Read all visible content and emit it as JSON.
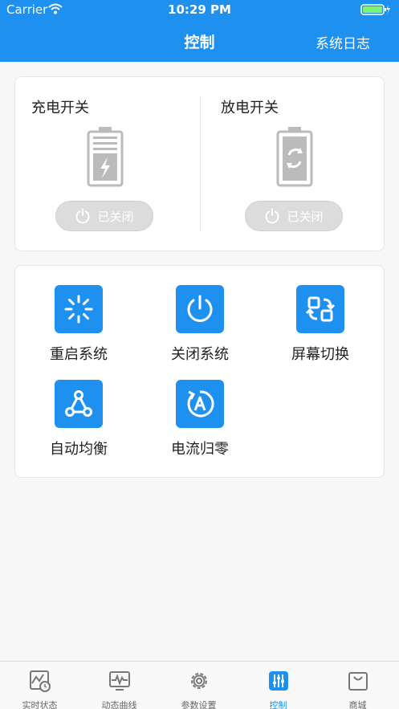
{
  "status_bar": {
    "carrier": "Carrier",
    "time": "10:29 PM"
  },
  "nav": {
    "title": "控制",
    "right_link": "系统日志"
  },
  "switches": [
    {
      "title": "充电开关",
      "button": "已关闭",
      "icon": "charging-battery-icon"
    },
    {
      "title": "放电开关",
      "button": "已关闭",
      "icon": "discharge-battery-icon"
    }
  ],
  "actions": [
    {
      "label": "重启系统",
      "icon": "restart-icon"
    },
    {
      "label": "关闭系统",
      "icon": "power-icon"
    },
    {
      "label": "屏幕切换",
      "icon": "screen-switch-icon"
    },
    {
      "label": "自动均衡",
      "icon": "balance-icon"
    },
    {
      "label": "电流归零",
      "icon": "current-zero-icon"
    }
  ],
  "tabs": [
    {
      "label": "实时状态",
      "icon": "realtime-status-icon"
    },
    {
      "label": "动态曲线",
      "icon": "dynamic-curve-icon"
    },
    {
      "label": "参数设置",
      "icon": "settings-gear-icon"
    },
    {
      "label": "控制",
      "icon": "control-sliders-icon",
      "active": true
    },
    {
      "label": "商城",
      "icon": "shopping-bag-icon"
    }
  ],
  "colors": {
    "accent": "#1e90f0",
    "disabled_button": "#dcdcdc"
  }
}
